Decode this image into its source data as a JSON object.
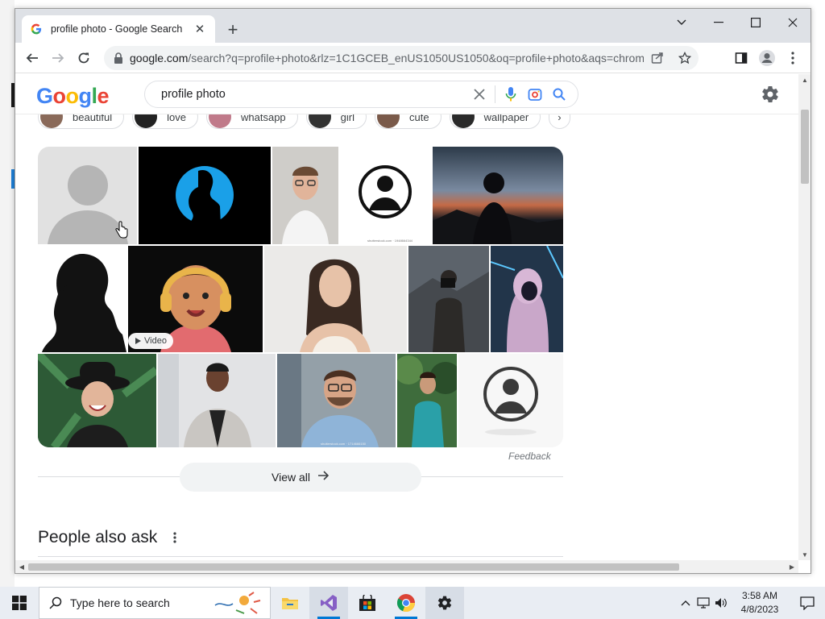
{
  "browser": {
    "tab_title": "profile photo - Google Search",
    "new_tab_symbol": "+",
    "url_host": "google.com",
    "url_path": "/search?q=profile+photo&rlz=1C1GCEB_enUS1050US1050&oq=profile+photo&aqs=chrome....",
    "window_controls": [
      "chevron-down-icon",
      "minimize-icon",
      "maximize-icon",
      "close-icon"
    ]
  },
  "google": {
    "logo_letters": [
      "G",
      "o",
      "o",
      "g",
      "l",
      "e"
    ],
    "logo_colors": [
      "#4285F4",
      "#EA4335",
      "#FBBC05",
      "#4285F4",
      "#34A853",
      "#EA4335"
    ],
    "query": "profile photo",
    "chips": [
      {
        "label": "beautiful",
        "color": "#8a6a5a"
      },
      {
        "label": "love",
        "color": "#222222"
      },
      {
        "label": "whatsapp",
        "color": "#c07a8a"
      },
      {
        "label": "girl",
        "color": "#333333"
      },
      {
        "label": "cute",
        "color": "#7a5a4a"
      },
      {
        "label": "wallpaper",
        "color": "#2a2a2a"
      }
    ],
    "images": [
      {
        "name": "image-default-avatar-gray",
        "desc_icon": "person-icon"
      },
      {
        "name": "image-blue-circle-silhouette",
        "desc_icon": "person-icon"
      },
      {
        "name": "image-man-glasses-portrait",
        "desc_icon": "person-icon"
      },
      {
        "name": "image-person-outline-icon",
        "caption": "shutterstock.com · 1948664344"
      },
      {
        "name": "image-silhouette-sunset",
        "desc_icon": "person-icon"
      },
      {
        "name": "image-silhouette-curly-hair",
        "desc_icon": "person-icon"
      },
      {
        "name": "image-3d-cartoon-headphones",
        "video_label": "Video"
      },
      {
        "name": "image-woman-long-hair",
        "desc_icon": "person-icon"
      },
      {
        "name": "image-photographer-mountains",
        "desc_icon": "person-icon"
      },
      {
        "name": "image-hooded-figure-neon",
        "desc_icon": "person-icon"
      },
      {
        "name": "image-woman-hat-laughing",
        "desc_icon": "person-icon"
      },
      {
        "name": "image-woman-blazer-smiling",
        "desc_icon": "person-icon"
      },
      {
        "name": "image-man-glasses-smiling",
        "caption": "shutterstock.com · 1714666150"
      },
      {
        "name": "image-man-teal-shirt-forest",
        "desc_icon": "person-icon"
      },
      {
        "name": "image-person-circle-icon",
        "desc_icon": "person-icon"
      }
    ],
    "feedback": "Feedback",
    "view_all": "View all",
    "people_also_ask": "People also ask"
  },
  "taskbar": {
    "search_placeholder": "Type here to search",
    "time": "3:58 AM",
    "date": "4/8/2023",
    "apps": [
      "file-explorer-icon",
      "visual-studio-icon",
      "store-icon",
      "chrome-icon",
      "settings-icon"
    ]
  }
}
